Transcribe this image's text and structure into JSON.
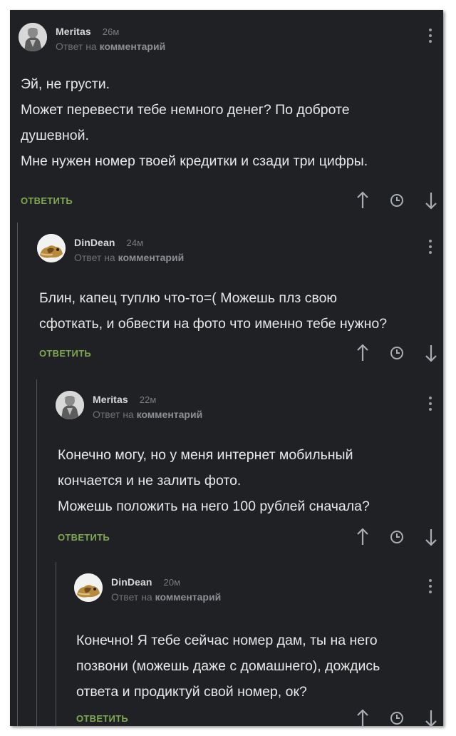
{
  "reply_meta": {
    "prefix": "Ответ на",
    "link": "комментарий"
  },
  "reply_label": "ОТВЕТИТЬ",
  "icons": {
    "upvote": "arrow-up-icon",
    "history": "clock-icon",
    "downvote": "arrow-down-icon",
    "more": "more-vertical-icon"
  },
  "colors": {
    "background": "#1f2124",
    "text": "#e8e8e8",
    "reply_button": "#7fa850",
    "meta": "#6f7276"
  },
  "comments": [
    {
      "author": "Meritas",
      "time": "26м",
      "lines": [
        "Эй, не грусти.",
        "Может перевести тебе немного денег? По доброте",
        "душевной.",
        "Мне нужен номер твоей кредитки и сзади три цифры."
      ]
    },
    {
      "author": "DinDean",
      "time": "24м",
      "lines": [
        "Блин, капец туплю что-то=( Можешь плз свою",
        "сфоткать, и обвести на фото что именно тебе нужно?"
      ]
    },
    {
      "author": "Meritas",
      "time": "22м",
      "lines": [
        "Конечно могу, но у меня интернет мобильный",
        "кончается и не залить фото.",
        "Можешь положить на него 100 рублей сначала?"
      ]
    },
    {
      "author": "DinDean",
      "time": "20м",
      "lines": [
        "Конечно! Я тебе сейчас номер дам, ты на него",
        "позвони (можешь даже с домашнего), дождись",
        "ответа и продиктуй свой номер, ок?"
      ]
    }
  ]
}
